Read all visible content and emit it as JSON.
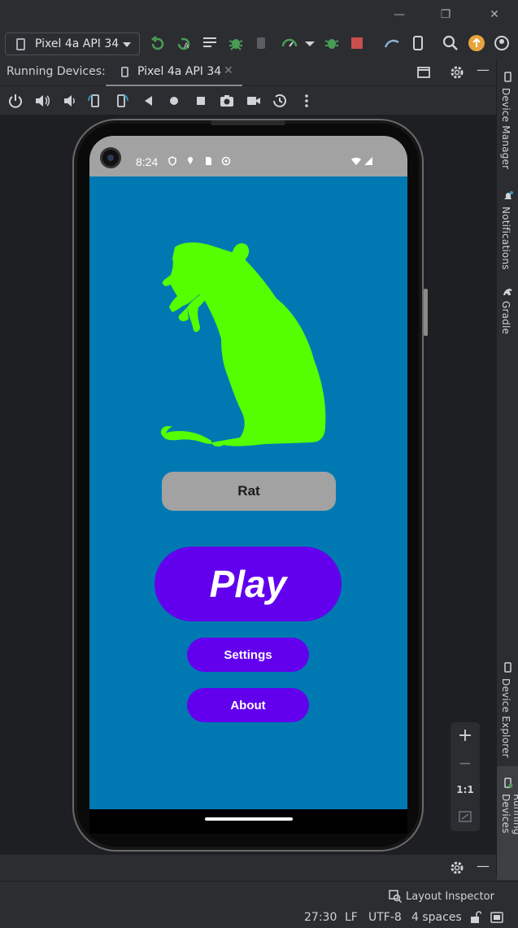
{
  "window": {
    "controls": [
      "minimize-icon",
      "restore-icon",
      "close-icon"
    ]
  },
  "toolbar": {
    "device_select": "Pixel 4a API 34",
    "icons": [
      "run-icon",
      "apply-changes-icon",
      "run-config-icon",
      "debug-icon",
      "attach-debugger-icon",
      "profiler-icon",
      "coverage-icon",
      "stop-icon",
      "device-mirror-icon",
      "device-file-icon",
      "search-icon",
      "update-icon",
      "settings-icon"
    ],
    "colors": {
      "run": "#499c54",
      "stop": "#c94f4f",
      "update": "#e8a33d"
    }
  },
  "running_devices": {
    "label": "Running Devices:",
    "tab_label": "Pixel 4a API 34"
  },
  "device_controls": [
    "power-icon",
    "volume-up-icon",
    "volume-down-icon",
    "rotate-left-icon",
    "rotate-right-icon",
    "back-icon",
    "home-icon",
    "overview-icon",
    "screenshot-icon",
    "screen-record-icon",
    "snapshot-icon",
    "more-icon"
  ],
  "right_sidebar": {
    "device_manager": "Device Manager",
    "notifications": "Notifications",
    "gradle": "Gradle",
    "device_explorer": "Device Explorer",
    "running_devices": "Running Devices"
  },
  "zoom": {
    "zoom_in": "+",
    "zoom_out": "−",
    "actual_size": "1:1"
  },
  "statusbar": {
    "layout_inspector": "Layout Inspector",
    "position": "27:30",
    "line_ending": "LF",
    "encoding": "UTF-8",
    "indent": "4 spaces"
  },
  "phone": {
    "status_time": "8:24",
    "status_icons": [
      "vpn-icon",
      "location-icon",
      "sd-card-icon",
      "sync-icon",
      "wifi-icon",
      "signal-icon"
    ],
    "screen_bg": "#0079b2",
    "image": "rat-silhouette-icon",
    "image_color": "#55ff00",
    "name_button": "Rat",
    "play_button": "Play",
    "settings_button": "Settings",
    "about_button": "About",
    "button_color": "#6200ee"
  }
}
